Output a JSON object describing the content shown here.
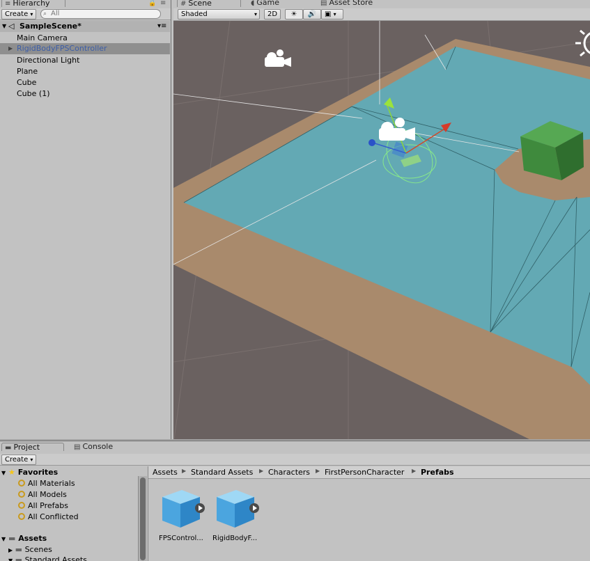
{
  "hierarchy": {
    "tab": "Hierarchy",
    "create": "Create",
    "search_placeholder": "All",
    "scene": "SampleScene*",
    "items": [
      {
        "label": "Main Camera"
      },
      {
        "label": "RigidBodyFPSController"
      },
      {
        "label": "Directional Light"
      },
      {
        "label": "Plane"
      },
      {
        "label": "Cube"
      },
      {
        "label": "Cube (1)"
      }
    ]
  },
  "scene": {
    "tabs": [
      {
        "label": "Scene"
      },
      {
        "label": "Game"
      },
      {
        "label": "Asset Store"
      }
    ],
    "toolbar": {
      "shading": "Shaded",
      "mode_2d": "2D"
    }
  },
  "project": {
    "tabs": [
      {
        "label": "Project"
      },
      {
        "label": "Console"
      }
    ],
    "create": "Create",
    "favorites": {
      "title": "Favorites",
      "items": [
        {
          "label": "All Materials"
        },
        {
          "label": "All Models"
        },
        {
          "label": "All Prefabs"
        },
        {
          "label": "All Conflicted"
        }
      ]
    },
    "assets": {
      "title": "Assets",
      "items": [
        {
          "label": "Scenes"
        },
        {
          "label": "Standard Assets"
        }
      ]
    },
    "breadcrumb": [
      "Assets",
      "Standard Assets",
      "Characters",
      "FirstPersonCharacter",
      "Prefabs"
    ],
    "files": [
      {
        "label": "FPSControl..."
      },
      {
        "label": "RigidBodyF..."
      }
    ]
  },
  "colors": {
    "ground": "#6a6160",
    "plane": "#63a9b4",
    "border": "#a98a6c",
    "cube": "#3f8a3d",
    "selection": "#3c5ea8"
  }
}
